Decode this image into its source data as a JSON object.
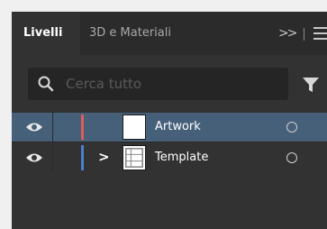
{
  "tabs": [
    {
      "label": "Livelli",
      "active": true
    },
    {
      "label": "3D e Materiali",
      "active": false
    }
  ],
  "tab_controls": {
    "collapse_icon": "double-chevron-right-icon",
    "menu_icon": "hamburger-menu-icon"
  },
  "search": {
    "placeholder": "Cerca tutto",
    "value": "",
    "icon": "search-icon",
    "filter_icon": "filter-icon"
  },
  "layers": [
    {
      "name": "Artwork",
      "visible": true,
      "color": "#e05c5c",
      "expandable": false,
      "selected": true,
      "target_icon": "target-circle-icon"
    },
    {
      "name": "Template",
      "visible": true,
      "color": "#4a7fd0",
      "expandable": true,
      "selected": false,
      "target_icon": "target-circle-icon"
    }
  ],
  "colors": {
    "selected_row": "#46607a",
    "panel_bg": "#323232",
    "tabbar_bg": "#2b2b2b"
  }
}
